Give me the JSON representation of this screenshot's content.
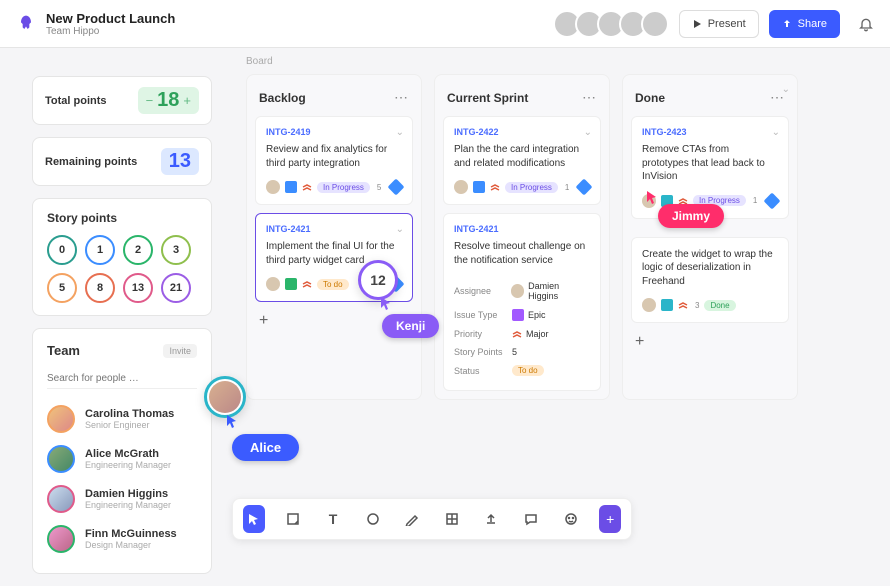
{
  "header": {
    "title": "New Product Launch",
    "subtitle": "Team Hippo",
    "present": "Present",
    "share": "Share"
  },
  "metrics": {
    "total_label": "Total points",
    "total_value": "18",
    "remaining_label": "Remaining points",
    "remaining_value": "13"
  },
  "story_points": {
    "title": "Story points",
    "chips": [
      "0",
      "1",
      "2",
      "3",
      "5",
      "8",
      "13",
      "21"
    ],
    "chip_colors": [
      "#2a9d8f",
      "#3b8dff",
      "#2ab56a",
      "#8fbf4d",
      "#f4a261",
      "#e76f51",
      "#e05a8a",
      "#9b5de5"
    ]
  },
  "team": {
    "title": "Team",
    "invite": "Invite",
    "search_placeholder": "Search for people …",
    "members": [
      {
        "name": "Carolina Thomas",
        "role": "Senior Engineer",
        "ring": "#f4a261"
      },
      {
        "name": "Alice McGrath",
        "role": "Engineering Manager",
        "ring": "#3b8dff"
      },
      {
        "name": "Damien Higgins",
        "role": "Engineering Manager",
        "ring": "#e05a8a"
      },
      {
        "name": "Finn McGuinness",
        "role": "Design Manager",
        "ring": "#2ab56a"
      }
    ]
  },
  "board_label": "Board",
  "columns": {
    "backlog": {
      "title": "Backlog",
      "cards": [
        {
          "id": "INTG-2419",
          "title": "Review and fix analytics for third party integration",
          "status": "In Progress",
          "pts": "5"
        },
        {
          "id": "INTG-2421",
          "title": "Implement the final UI for the third party widget card",
          "status": "To do",
          "pts": ""
        }
      ]
    },
    "sprint": {
      "title": "Current Sprint",
      "cards": [
        {
          "id": "INTG-2422",
          "title": "Plan the the card integration and related modifications",
          "status": "In Progress",
          "pts": "1"
        },
        {
          "id": "INTG-2421",
          "title": "Resolve timeout challenge on the notification service"
        }
      ],
      "detail": {
        "assignee_label": "Assignee",
        "assignee_val": "Damien Higgins",
        "issue_label": "Issue Type",
        "issue_val": "Epic",
        "priority_label": "Priority",
        "priority_val": "Major",
        "sp_label": "Story Points",
        "sp_val": "5",
        "status_label": "Status",
        "status_val": "To do"
      }
    },
    "done": {
      "title": "Done",
      "cards": [
        {
          "id": "INTG-2423",
          "title": "Remove CTAs from prototypes that lead back to InVision",
          "status": "In Progress",
          "pts": "1"
        },
        {
          "id": "",
          "title": "Create the widget to wrap the logic of deserialization in Freehand",
          "status": "Done",
          "pts": "3"
        }
      ]
    }
  },
  "cursors": {
    "kenji": "Kenji",
    "kenji_circle": "12",
    "jimmy": "Jimmy",
    "alice": "Alice"
  }
}
